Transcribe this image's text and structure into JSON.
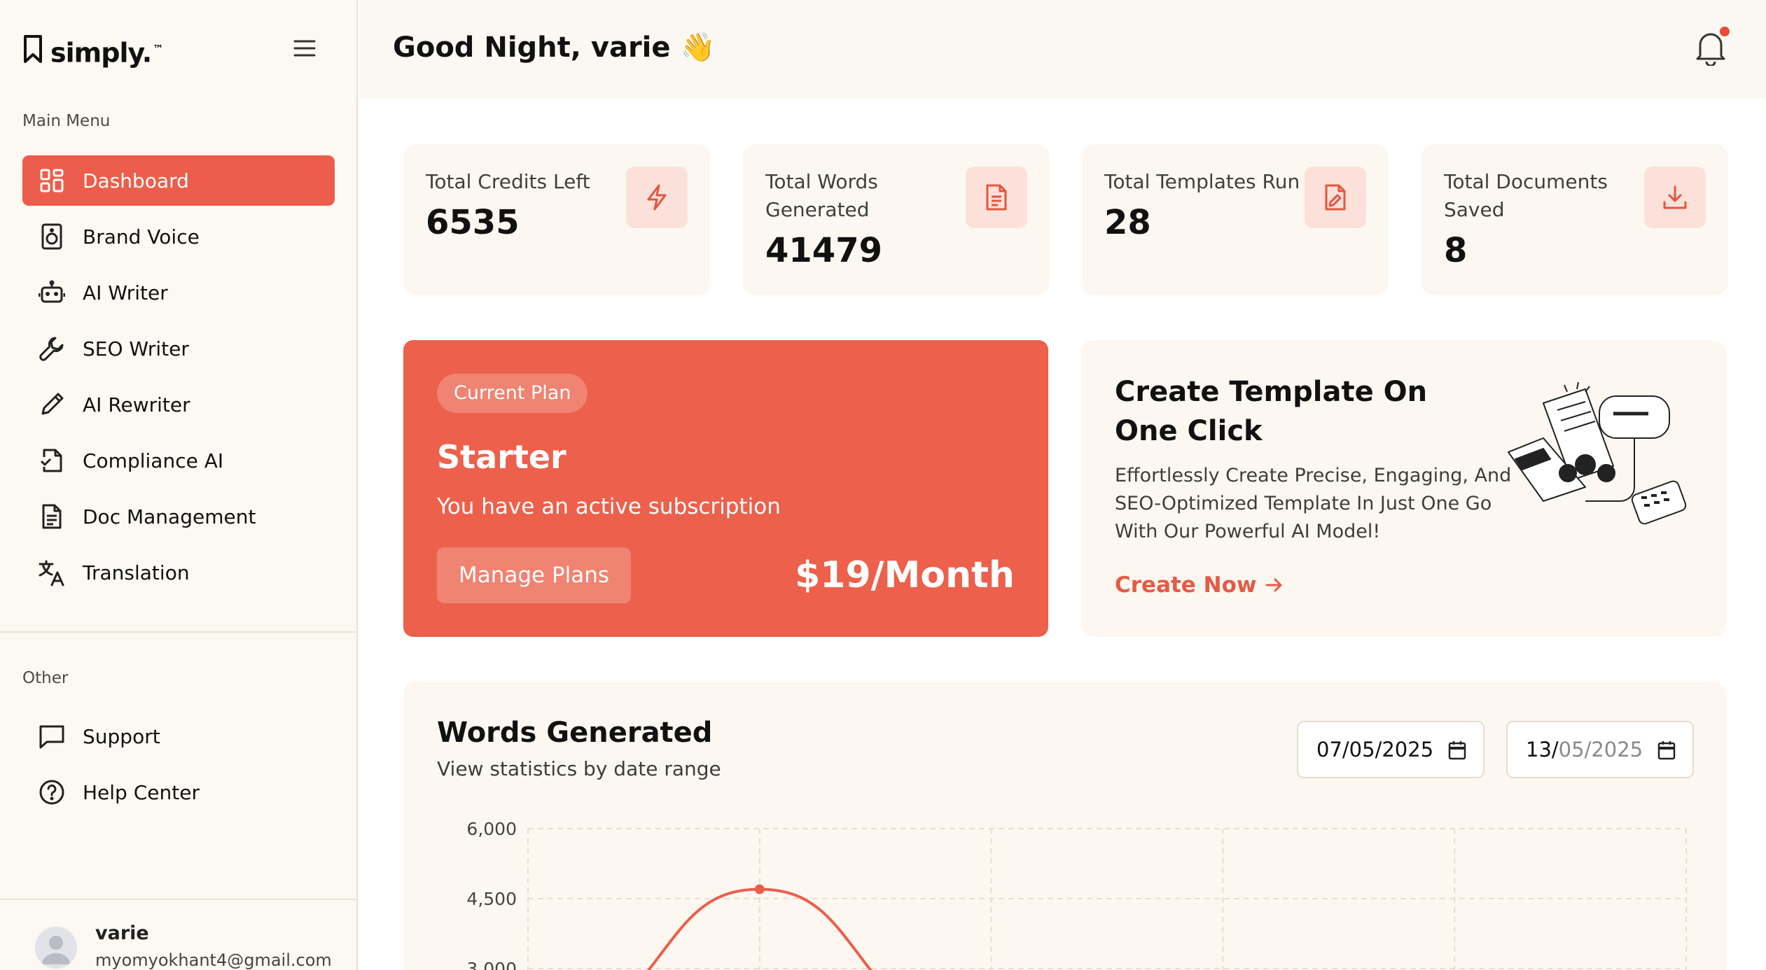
{
  "brand": {
    "name": "simply.",
    "tm": "™"
  },
  "sidebar": {
    "main_menu_label": "Main Menu",
    "items": [
      {
        "label": "Dashboard",
        "icon": "dashboard-grid-icon",
        "active": true
      },
      {
        "label": "Brand Voice",
        "icon": "speaker-icon"
      },
      {
        "label": "AI Writer",
        "icon": "robot-icon"
      },
      {
        "label": "SEO Writer",
        "icon": "wrench-icon"
      },
      {
        "label": "AI Rewriter",
        "icon": "pencil-icon"
      },
      {
        "label": "Compliance AI",
        "icon": "document-check-icon"
      },
      {
        "label": "Doc Management",
        "icon": "document-icon"
      },
      {
        "label": "Translation",
        "icon": "translate-icon"
      }
    ],
    "other_label": "Other",
    "other_items": [
      {
        "label": "Support",
        "icon": "chat-bubble-icon"
      },
      {
        "label": "Help Center",
        "icon": "question-circle-icon"
      }
    ],
    "user": {
      "name": "varie",
      "email": "myomyokhant4@gmail.com"
    }
  },
  "header": {
    "greeting": "Good Night, varie 👋"
  },
  "stats": [
    {
      "label": "Total Credits Left",
      "value": "6535",
      "icon": "lightning-icon"
    },
    {
      "label": "Total Words Generated",
      "value": "41479",
      "icon": "document-text-icon"
    },
    {
      "label": "Total Templates Run",
      "value": "28",
      "icon": "document-edit-icon"
    },
    {
      "label": "Total Documents Saved",
      "value": "8",
      "icon": "download-icon"
    }
  ],
  "plan": {
    "badge": "Current Plan",
    "name": "Starter",
    "description": "You have an active subscription",
    "button": "Manage Plans",
    "price": "$19/Month"
  },
  "template_promo": {
    "title": "Create Template On One Click",
    "description": "Effortlessly Create Precise, Engaging, And SEO-Optimized Template In Just One Go With Our Powerful AI Model!",
    "link": "Create Now"
  },
  "words_chart": {
    "title": "Words Generated",
    "subtitle": "View statistics by date range",
    "date_from": "07/05/2025",
    "date_to_day": "13/",
    "date_to_rest": "05/2025"
  },
  "colors": {
    "accent": "#ec5e4b",
    "card": "#fcf8f1",
    "sidebar": "#fcf9f3"
  },
  "chart_data": {
    "type": "line",
    "ylim": [
      0,
      6000
    ],
    "y_ticks": [
      "6,000",
      "4,500",
      "3,000"
    ],
    "x_categories": 6,
    "series": [
      {
        "values": [
          0,
          4700,
          0,
          0,
          0,
          0
        ]
      }
    ]
  }
}
